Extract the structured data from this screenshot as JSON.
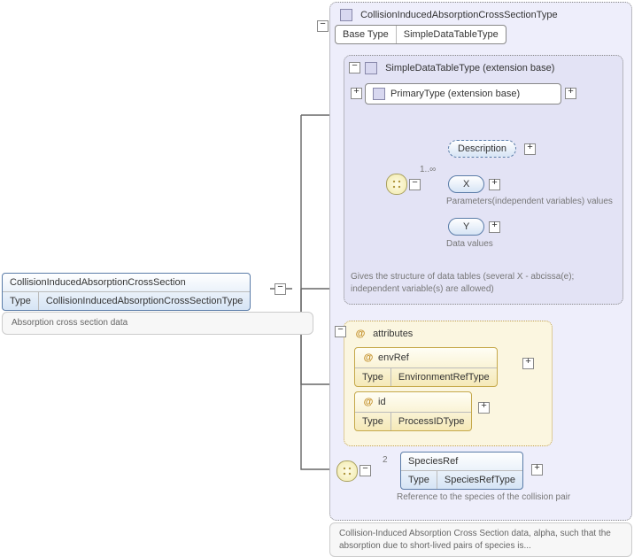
{
  "root": {
    "name": "CollisionInducedAbsorptionCrossSection",
    "typeLabel": "Type",
    "typeValue": "CollisionInducedAbsorptionCrossSectionType",
    "note": "Absorption cross section data"
  },
  "outer": {
    "header": "CollisionInducedAbsorptionCrossSectionType",
    "baseLabel": "Base Type",
    "baseValue": "SimpleDataTableType",
    "footerNote": "Collision-Induced Absorption Cross Section data, alpha, such that the absorption due to short-lived pairs of species is..."
  },
  "inner": {
    "header": "SimpleDataTableType (extension base)",
    "primary": "PrimaryType (extension base)",
    "seqCardinality": "1..∞",
    "desc": "Description",
    "x": "X",
    "xNote": "Parameters(independent variables) values",
    "y": "Y",
    "yNote": "Data values",
    "footerNote": "Gives the structure of data tables (several X - abcissa(e); independent variable(s) are allowed)"
  },
  "attrs": {
    "header": "attributes",
    "env": {
      "name": "envRef",
      "typeLabel": "Type",
      "typeValue": "EnvironmentRefType"
    },
    "id": {
      "name": "id",
      "typeLabel": "Type",
      "typeValue": "ProcessIDType"
    }
  },
  "species": {
    "cardinality": "2",
    "name": "SpeciesRef",
    "typeLabel": "Type",
    "typeValue": "SpeciesRefType",
    "note": "Reference to the species of the collision pair"
  }
}
